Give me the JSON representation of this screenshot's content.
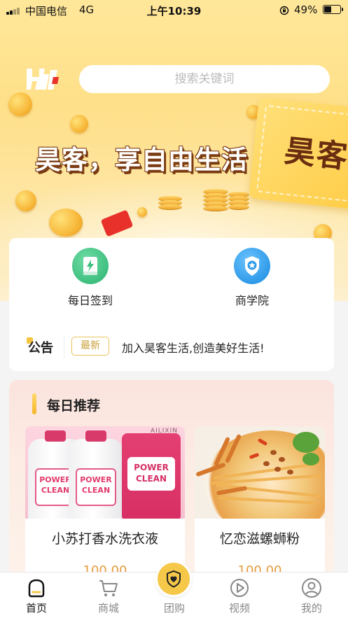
{
  "status_bar": {
    "carrier": "中国电信",
    "network": "4G",
    "time": "上午10:39",
    "battery_percent": "49%",
    "battery_level": 0.49
  },
  "header": {
    "search_placeholder": "搜索关键词",
    "banner_slogan": "昊客，享自由生活",
    "banner_ticket_text": "昊客"
  },
  "quick_entries": [
    {
      "label": "每日签到",
      "icon": "ebook-bolt-icon"
    },
    {
      "label": "商学院",
      "icon": "medal-star-icon"
    }
  ],
  "notice": {
    "title": "公告",
    "badge": "最新",
    "text": "加入昊客生活,创造美好生活!"
  },
  "daily_recommend": {
    "heading": "每日推荐",
    "products": [
      {
        "name": "小苏打香水洗衣液",
        "price": "100.00",
        "image_brand": "AILIXIN",
        "image_label_line1": "POWER",
        "image_label_line2": "CLEAN"
      },
      {
        "name": "忆恋滋螺蛳粉",
        "price": "100.00"
      }
    ]
  },
  "tabbar": {
    "items": [
      {
        "label": "首页",
        "icon": "home-icon",
        "active": true
      },
      {
        "label": "商城",
        "icon": "cart-icon",
        "active": false
      },
      {
        "label": "团购",
        "icon": "shield-heart-icon",
        "active": false
      },
      {
        "label": "视频",
        "icon": "play-icon",
        "active": false
      },
      {
        "label": "我的",
        "icon": "user-icon",
        "active": false
      }
    ]
  },
  "colors": {
    "brand_yellow": "#f5c84a",
    "price_orange": "#e89b3c",
    "badge_gold": "#c9a03a"
  }
}
